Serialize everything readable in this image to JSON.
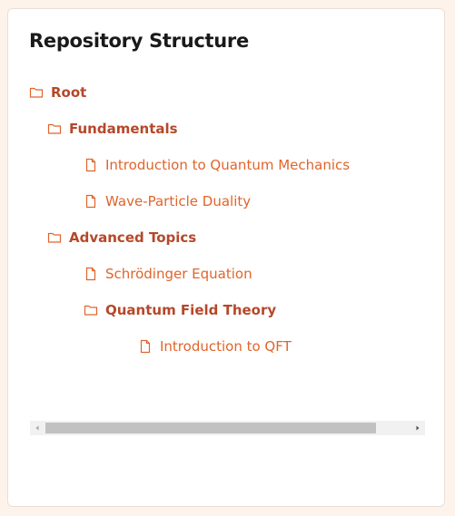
{
  "panel": {
    "title": "Repository Structure"
  },
  "tree": {
    "root": "Root",
    "fundamentals": "Fundamentals",
    "intro_qm": "Introduction to Quantum Mechanics",
    "wave_particle": "Wave-Particle Duality",
    "advanced": "Advanced Topics",
    "schrodinger": "Schrödinger Equation",
    "qft": "Quantum Field Theory",
    "intro_qft": "Introduction to QFT"
  },
  "icons": {
    "folder": "folder-icon",
    "file": "file-icon"
  },
  "colors": {
    "folder_text": "#b5482a",
    "file_text": "#e0642b",
    "icon": "#e0642b"
  }
}
